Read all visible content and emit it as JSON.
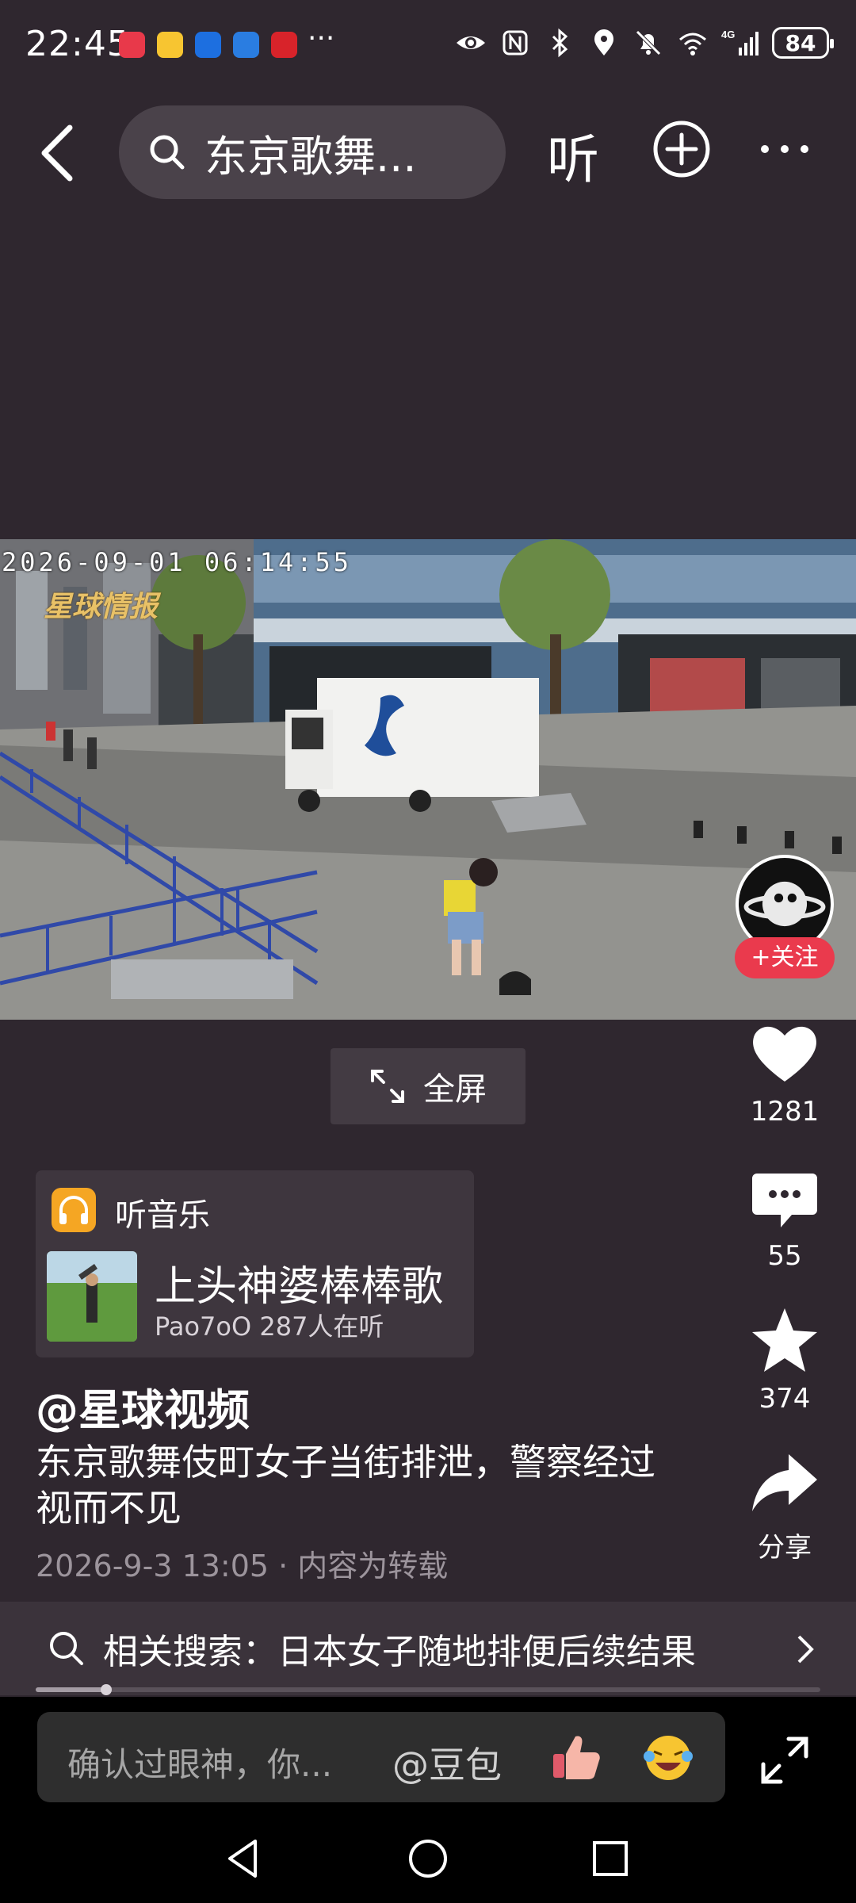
{
  "status_bar": {
    "time": "22:45",
    "battery": "84",
    "overflow": "···"
  },
  "top_nav": {
    "search_text": "东京歌舞...",
    "listen_label": "听"
  },
  "video": {
    "timestamp": "2026-09-01 06:14:55",
    "watermark": "星球情报",
    "fullscreen_label": "全屏"
  },
  "actions": {
    "follow_label": "+关注",
    "like_count": "1281",
    "comment_count": "55",
    "favorite_count": "374",
    "share_label": "分享"
  },
  "music": {
    "header": "听音乐",
    "song_title": "上头神婆棒棒歌",
    "meta": "Pao7oO 287人在听"
  },
  "post": {
    "author": "@星球视频",
    "description": "东京歌舞伎町女子当街排泄，警察经过视而不见",
    "meta": "2026-9-3 13:05 · 内容为转载"
  },
  "related": {
    "text": "相关搜索：日本女子随地排便后续结果"
  },
  "progress": {
    "fraction": 0.09
  },
  "comment_bar": {
    "placeholder": "确认过眼神，你...",
    "mention": "@豆包"
  },
  "colors": {
    "background": "#2f272f",
    "follow": "#ea3a4d",
    "music_icon": "#f5a623"
  }
}
